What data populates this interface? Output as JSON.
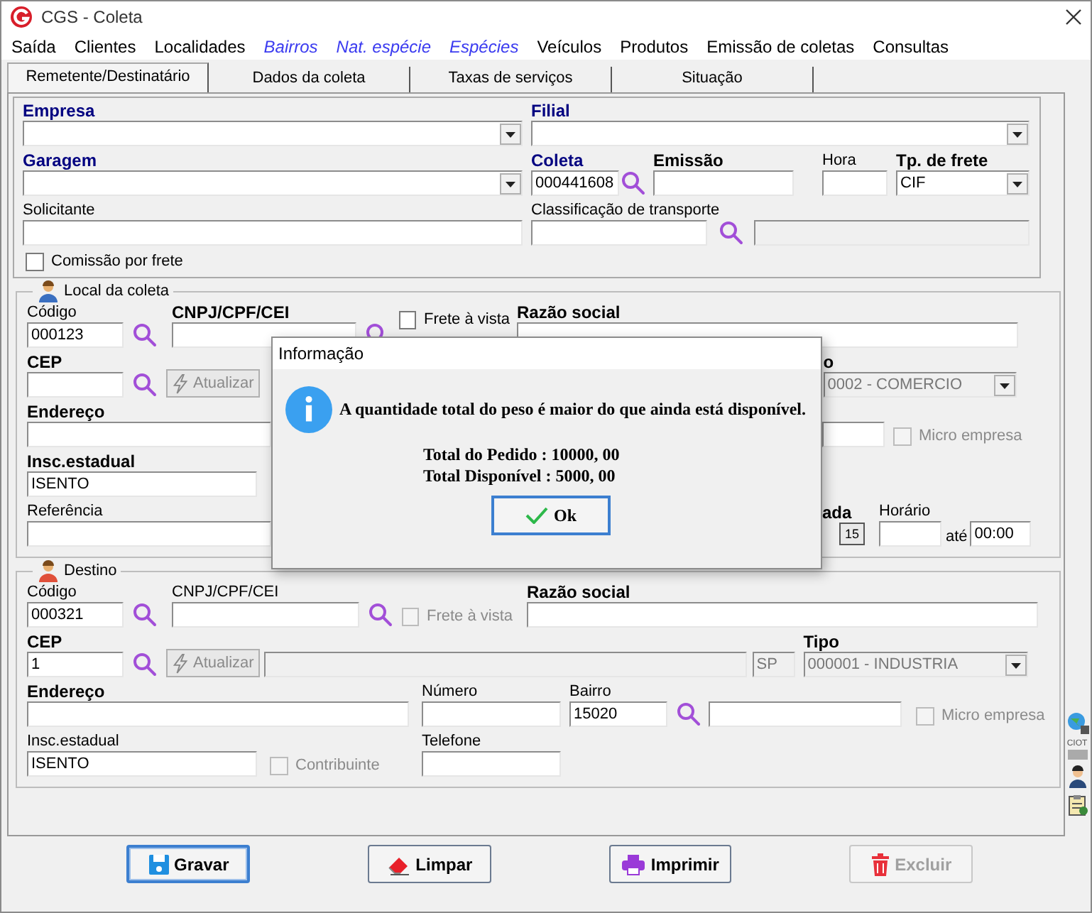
{
  "window": {
    "title": "CGS - Coleta"
  },
  "menu": [
    {
      "label": "Saída",
      "kind": "menu"
    },
    {
      "label": "Clientes",
      "kind": "menu"
    },
    {
      "label": "Localidades",
      "kind": "menu"
    },
    {
      "label": "Bairros",
      "kind": "shortcut"
    },
    {
      "label": "Nat. espécie",
      "kind": "shortcut"
    },
    {
      "label": "Espécies",
      "kind": "shortcut"
    },
    {
      "label": "Veículos",
      "kind": "menu"
    },
    {
      "label": "Produtos",
      "kind": "menu"
    },
    {
      "label": "Emissão de coletas",
      "kind": "menu"
    },
    {
      "label": "Consultas",
      "kind": "menu"
    }
  ],
  "tabs": [
    {
      "label": "Remetente/Destinatário",
      "selected": true
    },
    {
      "label": "Dados da coleta",
      "selected": false
    },
    {
      "label": "Taxas de serviços",
      "selected": false
    },
    {
      "label": "Situação",
      "selected": false
    }
  ],
  "header": {
    "empresa": {
      "label": "Empresa",
      "bold": true,
      "required": true
    },
    "filial": {
      "label": "Filial",
      "bold": true,
      "required": true
    },
    "garagem": {
      "label": "Garagem",
      "bold": true,
      "required": true
    },
    "coleta": {
      "label": "Coleta",
      "bold": true,
      "required": true,
      "value": "000441608"
    },
    "emissao": {
      "label": "Emissão",
      "bold": true,
      "required": false
    },
    "hora": {
      "label": "Hora",
      "bold": false,
      "required": false
    },
    "frete": {
      "label": "Tp. de frete",
      "bold": true,
      "required": false,
      "value": "CIF"
    },
    "solicitante": {
      "label": "Solicitante",
      "bold": false,
      "required": false
    },
    "classificacao": {
      "label": "Classificação de transporte",
      "bold": false,
      "required": false
    },
    "classificacao_descricao": {
      "disabled": true
    },
    "comissao": {
      "label": "Comissão por frete",
      "checked": false,
      "disabled": false
    }
  },
  "origin": {
    "title": "Local da coleta",
    "codigo": {
      "label": "Código",
      "bold": false,
      "required": false,
      "value": "000123"
    },
    "cnpj": {
      "label": "CNPJ/CPF/CEI",
      "bold": true,
      "required": false
    },
    "frete_a_vista": {
      "label": "Frete à vista",
      "checked": false,
      "disabled": false
    },
    "razao_social": {
      "label": "Razão social",
      "bold": true,
      "required": false
    },
    "cep": {
      "label": "CEP",
      "bold": true,
      "required": false
    },
    "atualizar": {
      "label": "Atualizar",
      "disabled": true
    },
    "tipo": {
      "label": "o",
      "bold": true,
      "required": false,
      "value": "0002 - COMERCIO",
      "disabled": true
    },
    "endereco": {
      "label": "Endereço",
      "bold": true,
      "required": false
    },
    "micro_empresa": {
      "label": "Micro empresa",
      "checked": false,
      "disabled": true
    },
    "insc_estadual": {
      "label": "Insc.estadual",
      "bold": true,
      "required": false,
      "value": "ISENTO"
    },
    "referencia": {
      "label": "Referência",
      "bold": false,
      "required": false
    },
    "data": {
      "label": "ada",
      "bold": true,
      "required": false,
      "calendar": "15"
    },
    "horario": {
      "label": "Horário",
      "bold": false,
      "required": false
    },
    "ate": {
      "label": "até",
      "value": "00:00"
    }
  },
  "destination": {
    "title": "Destino",
    "codigo": {
      "label": "Código",
      "bold": false,
      "required": false,
      "value": "000321"
    },
    "cnpj": {
      "label": "CNPJ/CPF/CEI",
      "bold": false,
      "required": false
    },
    "frete_a_vista": {
      "label": "Frete à vista",
      "checked": false,
      "disabled": true
    },
    "razao_social": {
      "label": "Razão social",
      "bold": true,
      "required": false
    },
    "cep": {
      "label": "CEP",
      "bold": true,
      "required": false,
      "value": "1"
    },
    "atualizar": {
      "label": "Atualizar",
      "disabled": true
    },
    "cep_descricao": {
      "disabled": true
    },
    "uf": {
      "value": "SP",
      "disabled": true
    },
    "tipo": {
      "label": "Tipo",
      "bold": true,
      "required": false,
      "value": "000001 - INDUSTRIA",
      "disabled": true
    },
    "endereco": {
      "label": "Endereço",
      "bold": true,
      "required": false
    },
    "numero": {
      "label": "Número",
      "bold": false,
      "required": false
    },
    "bairro": {
      "label": "Bairro",
      "bold": false,
      "required": false,
      "value": "15020"
    },
    "micro_empresa": {
      "label": "Micro empresa",
      "checked": false,
      "disabled": true
    },
    "insc_estadual": {
      "label": "Insc.estadual",
      "bold": false,
      "required": false,
      "value": "ISENTO"
    },
    "contribuinte": {
      "label": "Contribuinte",
      "checked": false,
      "disabled": true
    },
    "telefone": {
      "label": "Telefone",
      "bold": false,
      "required": false
    }
  },
  "side_toolbar": {
    "ciot": "CIOT"
  },
  "buttons": [
    {
      "label": "Gravar",
      "kind": "save",
      "disabled": false,
      "focused": true
    },
    {
      "label": "Limpar",
      "kind": "clear",
      "disabled": false,
      "focused": false
    },
    {
      "label": "Imprimir",
      "kind": "print",
      "disabled": false,
      "focused": false
    },
    {
      "label": "Excluir",
      "kind": "delete",
      "disabled": true,
      "focused": false
    }
  ],
  "dialog": {
    "title": "Informação",
    "message": "A quantidade total do peso é maior do que ainda está disponível.",
    "details": [
      "Total do Pedido : 10000, 00",
      "Total Disponível : 5000, 00"
    ],
    "button": "Ok"
  }
}
